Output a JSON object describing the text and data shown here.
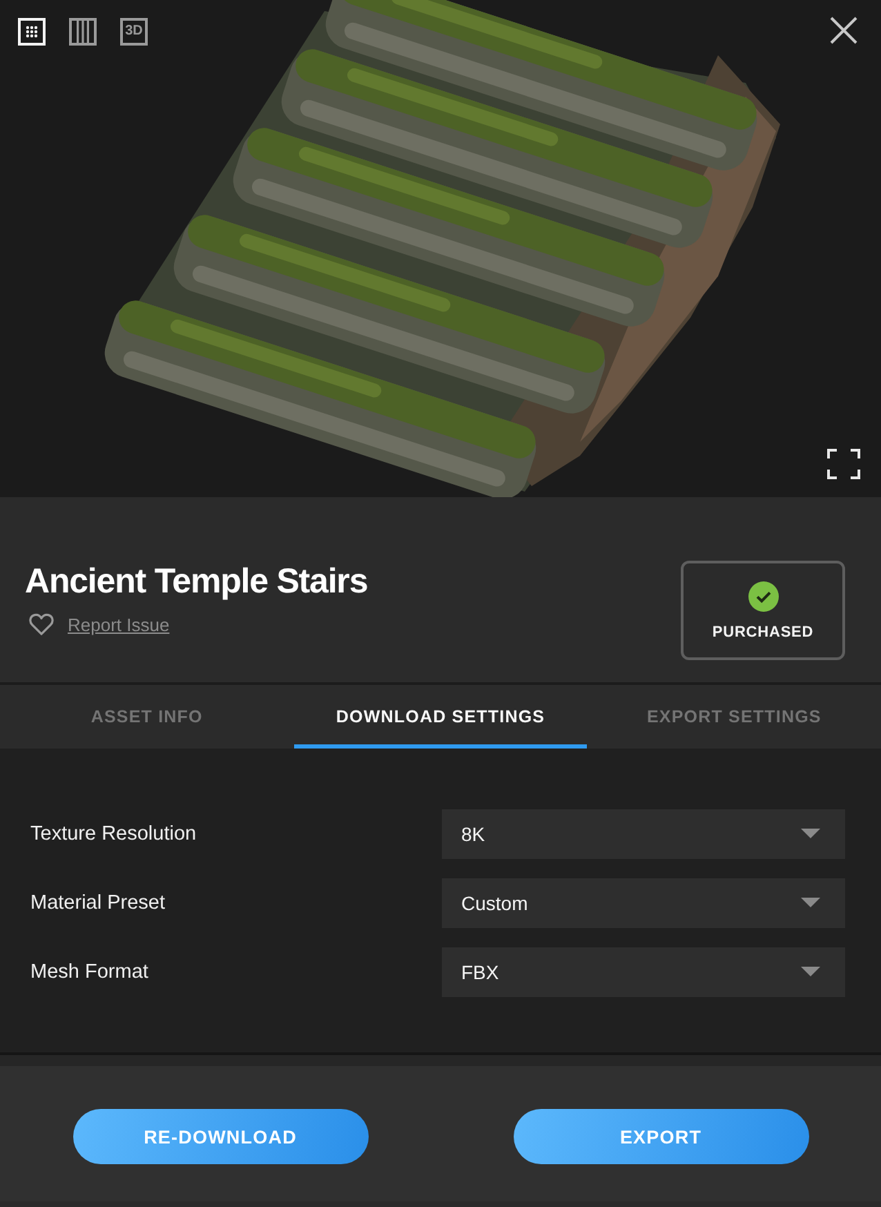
{
  "viewer": {
    "view_modes": [
      {
        "kind": "grid",
        "selected": true
      },
      {
        "kind": "columns",
        "selected": false
      },
      {
        "kind": "model",
        "label": "3D",
        "selected": false
      }
    ]
  },
  "asset": {
    "title": "Ancient Temple Stairs",
    "report_link": "Report Issue",
    "status": "PURCHASED"
  },
  "tabs": [
    {
      "label": "ASSET INFO",
      "selected": false
    },
    {
      "label": "DOWNLOAD SETTINGS",
      "selected": true
    },
    {
      "label": "EXPORT SETTINGS",
      "selected": false
    }
  ],
  "settings": [
    {
      "label": "Texture Resolution",
      "value": "8K"
    },
    {
      "label": "Material Preset",
      "value": "Custom"
    },
    {
      "label": "Mesh Format",
      "value": "FBX"
    }
  ],
  "buttons": [
    "RE-DOWNLOAD",
    "EXPORT"
  ]
}
